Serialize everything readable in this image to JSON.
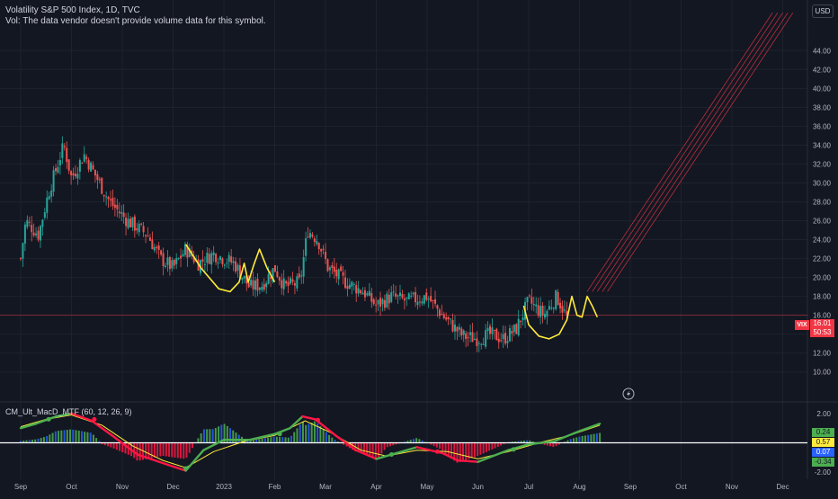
{
  "header": {
    "title": "Volatility S&P 500 Index, 1D, TVC",
    "vol_note": "Vol: The data vendor doesn't provide volume data for this symbol.",
    "currency": "USD"
  },
  "indicator": {
    "label": "CM_Ult_MacD_MTF (60, 12, 26, 9)",
    "badges": [
      "0.24",
      "0.57",
      "0.07",
      "-0.34"
    ]
  },
  "price_badge": {
    "symbol": "VIX",
    "price": "16.01",
    "countdown": "50:53"
  },
  "colors": {
    "background": "#131722",
    "up": "#26a69a",
    "down": "#ef5350",
    "pattern_line": "#ffeb3b",
    "projection": "#f23645",
    "macd_up": "#4caf50",
    "macd_down": "#ff1744",
    "signal": "#ffeb3b",
    "histogram_up": "#2962ff",
    "histogram_down": "#ff1744"
  },
  "icons": {
    "flash": "lightning-bolt-icon"
  },
  "chart_data": [
    {
      "type": "candlestick",
      "title": "Volatility S&P 500 Index, 1D, TVC",
      "xlabel": "",
      "ylabel": "",
      "ylim": [
        7.5,
        46.5
      ],
      "y_ticks": [
        "10.00",
        "12.00",
        "14.00",
        "16.00",
        "18.00",
        "20.00",
        "22.00",
        "24.00",
        "26.00",
        "28.00",
        "30.00",
        "32.00",
        "34.00",
        "36.00",
        "38.00",
        "40.00",
        "42.00",
        "44.00"
      ],
      "x_ticks": [
        "Sep",
        "Oct",
        "Nov",
        "Dec",
        "2023",
        "Feb",
        "Mar",
        "Apr",
        "May",
        "Jun",
        "Jul",
        "Aug",
        "Sep",
        "Oct",
        "Nov",
        "Dec"
      ],
      "last_price": 16.01,
      "grid": true,
      "close_path": [
        {
          "x": 0,
          "y": 22.0
        },
        {
          "x": 0.1,
          "y": 26.0
        },
        {
          "x": 0.35,
          "y": 24.5
        },
        {
          "x": 0.55,
          "y": 29.0
        },
        {
          "x": 0.85,
          "y": 34.0
        },
        {
          "x": 1.0,
          "y": 30.5
        },
        {
          "x": 1.25,
          "y": 33.0
        },
        {
          "x": 1.45,
          "y": 31.0
        },
        {
          "x": 1.75,
          "y": 28.0
        },
        {
          "x": 2.1,
          "y": 26.0
        },
        {
          "x": 2.5,
          "y": 24.5
        },
        {
          "x": 2.75,
          "y": 22.0
        },
        {
          "x": 3.0,
          "y": 21.0
        },
        {
          "x": 3.25,
          "y": 23.0
        },
        {
          "x": 3.5,
          "y": 21.5
        },
        {
          "x": 3.8,
          "y": 22.5
        },
        {
          "x": 4.2,
          "y": 21.5
        },
        {
          "x": 4.5,
          "y": 19.0
        },
        {
          "x": 4.75,
          "y": 19.2
        },
        {
          "x": 5.0,
          "y": 21.0
        },
        {
          "x": 5.2,
          "y": 19.0
        },
        {
          "x": 5.5,
          "y": 19.5
        },
        {
          "x": 5.65,
          "y": 25.0
        },
        {
          "x": 5.85,
          "y": 24.0
        },
        {
          "x": 6.05,
          "y": 21.0
        },
        {
          "x": 6.4,
          "y": 19.5
        },
        {
          "x": 6.75,
          "y": 18.5
        },
        {
          "x": 7.0,
          "y": 17.0
        },
        {
          "x": 7.3,
          "y": 18.0
        },
        {
          "x": 7.6,
          "y": 17.5
        },
        {
          "x": 8.0,
          "y": 18.0
        },
        {
          "x": 8.3,
          "y": 16.0
        },
        {
          "x": 8.7,
          "y": 13.8
        },
        {
          "x": 9.0,
          "y": 13.5
        },
        {
          "x": 9.25,
          "y": 14.0
        },
        {
          "x": 9.5,
          "y": 13.5
        },
        {
          "x": 9.75,
          "y": 14.5
        },
        {
          "x": 10.0,
          "y": 17.5
        },
        {
          "x": 10.3,
          "y": 16.0
        },
        {
          "x": 10.55,
          "y": 18.0
        },
        {
          "x": 10.75,
          "y": 15.8
        }
      ],
      "pattern_lines": [
        {
          "name": "decline",
          "points": [
            [
              3.25,
              23.5
            ],
            [
              3.55,
              21.0
            ],
            [
              3.9,
              18.8
            ],
            [
              4.12,
              18.5
            ],
            [
              4.3,
              19.5
            ],
            [
              4.4,
              21.5
            ],
            [
              4.48,
              19.5
            ],
            [
              4.6,
              21.5
            ],
            [
              4.7,
              23.0
            ],
            [
              4.85,
              21.0
            ],
            [
              5.0,
              19.5
            ]
          ]
        },
        {
          "name": "cup",
          "points": [
            [
              9.9,
              17.0
            ],
            [
              10.0,
              15.0
            ],
            [
              10.2,
              13.8
            ],
            [
              10.4,
              13.5
            ],
            [
              10.6,
              14.0
            ],
            [
              10.75,
              15.5
            ],
            [
              10.85,
              18.0
            ],
            [
              10.95,
              16.0
            ],
            [
              11.05,
              15.8
            ],
            [
              11.15,
              18.0
            ],
            [
              11.25,
              17.0
            ],
            [
              11.35,
              15.8
            ]
          ]
        }
      ],
      "projection": {
        "count": 5,
        "from": [
          11.15,
          18.5
        ],
        "to": [
          14.8,
          48.0
        ]
      }
    },
    {
      "type": "line",
      "title": "CM_Ult_MacD_MTF (60, 12, 26, 9)",
      "ylim": [
        -2.3,
        2.3
      ],
      "y_ticks": [
        "-2.00",
        "2.00"
      ],
      "series": [
        {
          "name": "",
          "points": [
            [
              0,
              1.0
            ],
            [
              0.3,
              1.3
            ],
            [
              0.7,
              1.8
            ],
            [
              1.0,
              2.0
            ],
            [
              1.4,
              1.5
            ],
            [
              1.8,
              0.5
            ],
            [
              2.3,
              -0.8
            ],
            [
              2.9,
              -1.5
            ],
            [
              3.25,
              -1.9
            ],
            [
              3.6,
              -0.5
            ],
            [
              4.0,
              0.2
            ],
            [
              4.5,
              0.2
            ],
            [
              5.0,
              0.6
            ],
            [
              5.3,
              1.0
            ],
            [
              5.55,
              1.8
            ],
            [
              5.8,
              1.6
            ],
            [
              6.2,
              0.5
            ],
            [
              6.6,
              -0.5
            ],
            [
              7.0,
              -1.1
            ],
            [
              7.4,
              -0.7
            ],
            [
              7.8,
              -0.3
            ],
            [
              8.3,
              -0.7
            ],
            [
              8.6,
              -1.2
            ],
            [
              9.0,
              -1.3
            ],
            [
              9.3,
              -0.9
            ],
            [
              9.6,
              -0.5
            ],
            [
              10.0,
              -0.1
            ],
            [
              10.5,
              0.1
            ],
            [
              11.0,
              0.8
            ],
            [
              11.4,
              1.3
            ]
          ]
        },
        {
          "name": "",
          "points": [
            [
              0,
              1.1
            ],
            [
              0.5,
              1.6
            ],
            [
              1.0,
              1.9
            ],
            [
              1.6,
              1.2
            ],
            [
              2.2,
              -0.2
            ],
            [
              2.8,
              -1.2
            ],
            [
              3.25,
              -1.7
            ],
            [
              3.8,
              -0.6
            ],
            [
              4.4,
              0.1
            ],
            [
              5.0,
              0.5
            ],
            [
              5.6,
              1.5
            ],
            [
              6.1,
              0.7
            ],
            [
              6.7,
              -0.5
            ],
            [
              7.2,
              -0.9
            ],
            [
              7.8,
              -0.5
            ],
            [
              8.4,
              -0.6
            ],
            [
              9.0,
              -1.1
            ],
            [
              9.6,
              -0.6
            ],
            [
              10.2,
              0.0
            ],
            [
              10.8,
              0.5
            ],
            [
              11.4,
              1.2
            ]
          ]
        }
      ],
      "zero_line": 0
    }
  ]
}
